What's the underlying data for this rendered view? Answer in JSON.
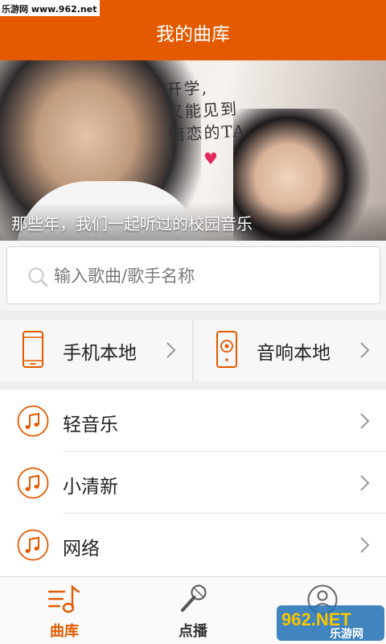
{
  "watermark_top": "乐游网 www.962.net",
  "header": {
    "title": "我的曲库"
  },
  "banner": {
    "handwriting_line1": "开学,",
    "handwriting_line2": "又能见到",
    "handwriting_line3": "暗恋的TA",
    "caption": "那些年，我们一起听过的校园音乐"
  },
  "search": {
    "placeholder": "输入歌曲/歌手名称",
    "value": ""
  },
  "local": [
    {
      "label": "手机本地",
      "icon": "phone-icon"
    },
    {
      "label": "音响本地",
      "icon": "speaker-icon"
    }
  ],
  "categories": [
    {
      "label": "轻音乐",
      "icon": "music-note-icon"
    },
    {
      "label": "小清新",
      "icon": "music-note-icon"
    },
    {
      "label": "网络",
      "icon": "music-note-icon"
    }
  ],
  "tabs": [
    {
      "label": "曲库",
      "icon": "library-icon",
      "active": true
    },
    {
      "label": "点播",
      "icon": "microphone-icon",
      "active": false
    },
    {
      "label": "",
      "icon": "profile-icon",
      "active": false
    }
  ],
  "watermark_bottom": {
    "logo": "962.NET",
    "text": "乐游网"
  },
  "colors": {
    "accent": "#e35a00",
    "text": "#222222",
    "divider": "#e6e6e6"
  }
}
